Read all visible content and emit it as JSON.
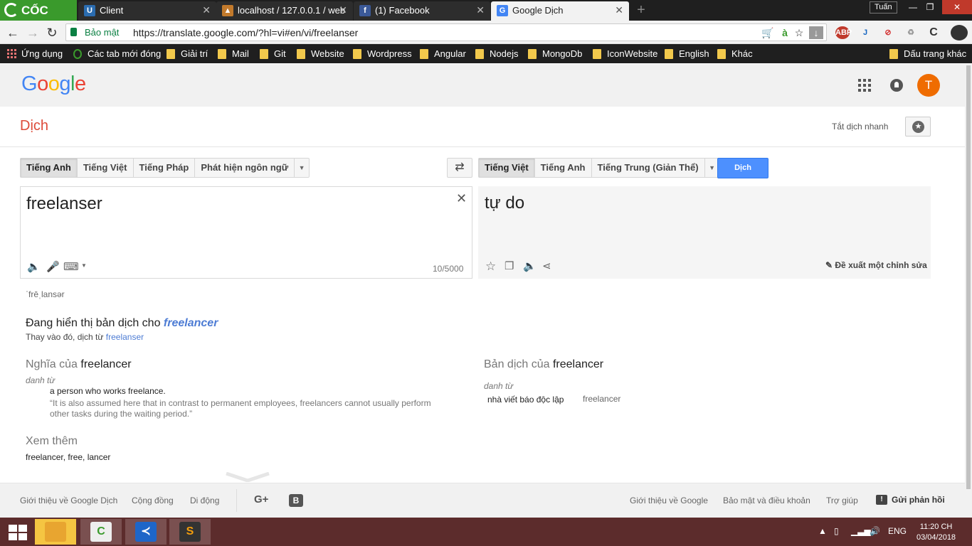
{
  "browser": {
    "brand": "CỐC CỐC",
    "tabs": [
      {
        "title": "Client"
      },
      {
        "title": "localhost / 127.0.0.1 / web"
      },
      {
        "title": "(1) Facebook"
      },
      {
        "title": "Google Dịch"
      }
    ],
    "user": "Tuấn",
    "secure_label": "Bảo mật",
    "url": "https://translate.google.com/?hl=vi#en/vi/freelanser",
    "bookmarks": [
      "Ứng dụng",
      "Các tab mới đóng",
      "Giải trí",
      "Mail",
      "Git",
      "Website",
      "Wordpress",
      "Angular",
      "Nodejs",
      "MongoDb",
      "IconWebsite",
      "English",
      "Khác",
      "Dấu trang khác"
    ]
  },
  "google": {
    "logo": [
      "G",
      "o",
      "o",
      "g",
      "l",
      "e"
    ],
    "avatar_letter": "T"
  },
  "translate": {
    "title": "Dịch",
    "instant_label": "Tắt dịch nhanh",
    "source_langs": [
      "Tiếng Anh",
      "Tiếng Việt",
      "Tiếng Pháp",
      "Phát hiện ngôn ngữ"
    ],
    "target_langs": [
      "Tiếng Việt",
      "Tiếng Anh",
      "Tiếng Trung (Giản Thể)"
    ],
    "translate_button": "Dịch",
    "source_text": "freelanser",
    "char_count": "10/5000",
    "target_text": "tự do",
    "suggest_edit": "Đề xuất một chỉnh sửa",
    "phonetic": "ˈfrēˌlansər",
    "showing_prefix": "Đang hiển thị bản dịch cho",
    "corrected_word": "freelancer",
    "instead_prefix": "Thay vào đó, dịch từ",
    "original_word": "freelanser",
    "definitions": {
      "heading_prefix": "Nghĩa của",
      "word": "freelancer",
      "part_of_speech": "danh từ",
      "definition": "a person who works freelance.",
      "example": "“It is also assumed here that in contrast to permanent employees, freelancers cannot usually perform other tasks during the waiting period.”"
    },
    "see_also": {
      "heading": "Xem thêm",
      "words": "freelancer, free, lancer"
    },
    "translations": {
      "heading_prefix": "Bản dịch của",
      "word": "freelancer",
      "part_of_speech": "danh từ",
      "translation": "nhà viết báo độc lập",
      "back_translation": "freelancer"
    }
  },
  "footer": {
    "left_links": [
      "Giới thiệu về Google Dịch",
      "Cộng đồng",
      "Di động"
    ],
    "right_links": [
      "Giới thiệu về Google",
      "Bảo mật và điều khoản",
      "Trợ giúp"
    ],
    "feedback": "Gửi phản hồi"
  },
  "taskbar": {
    "lang": "ENG",
    "time": "11:20 CH",
    "date": "03/04/2018"
  }
}
